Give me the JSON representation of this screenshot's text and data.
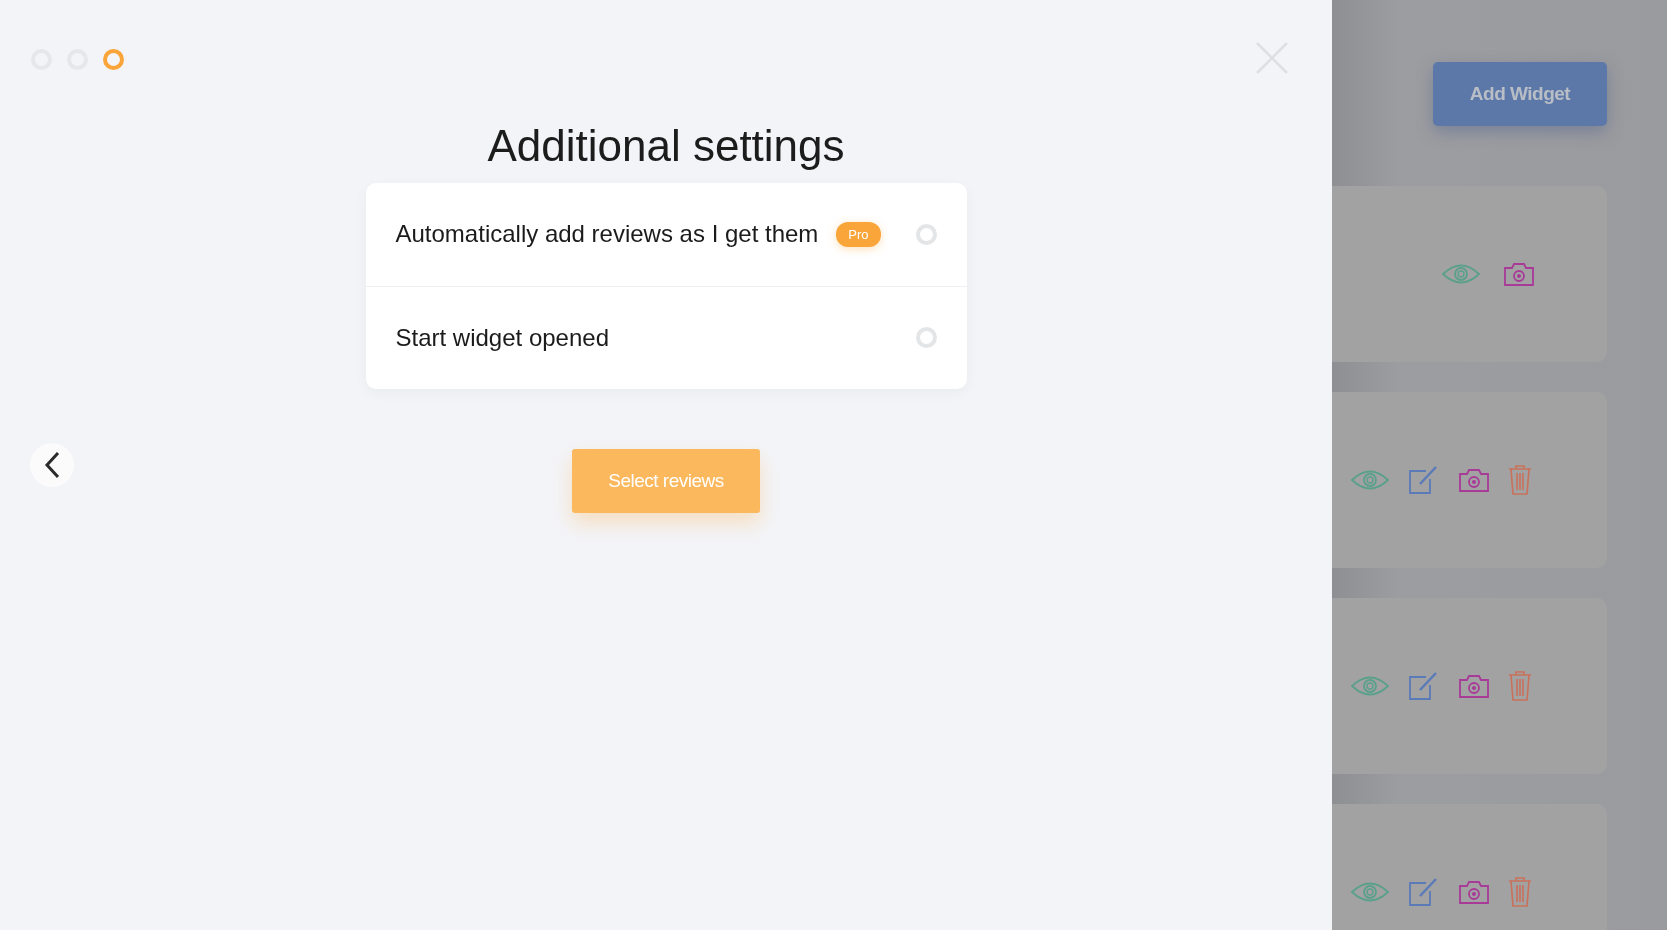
{
  "steps": [
    {
      "selected": false
    },
    {
      "selected": false
    },
    {
      "selected": true
    }
  ],
  "title": "Additional settings",
  "options": [
    {
      "label": "Automatically add reviews as I get them",
      "badge": "Pro",
      "checked": false
    },
    {
      "label": "Start widget opened",
      "checked": false
    }
  ],
  "primary_button": "Select reviews",
  "background": {
    "add_button": "Add Widget",
    "widgets": [
      {
        "actions": [
          {
            "kind": "view"
          },
          {
            "kind": "snapshot"
          }
        ]
      },
      {
        "actions": [
          {
            "kind": "view"
          },
          {
            "kind": "edit"
          },
          {
            "kind": "snapshot"
          },
          {
            "kind": "delete"
          }
        ]
      },
      {
        "actions": [
          {
            "kind": "view"
          },
          {
            "kind": "edit"
          },
          {
            "kind": "snapshot"
          },
          {
            "kind": "delete"
          }
        ]
      },
      {
        "actions": [
          {
            "kind": "view"
          },
          {
            "kind": "edit"
          },
          {
            "kind": "snapshot"
          },
          {
            "kind": "delete"
          }
        ]
      }
    ]
  }
}
